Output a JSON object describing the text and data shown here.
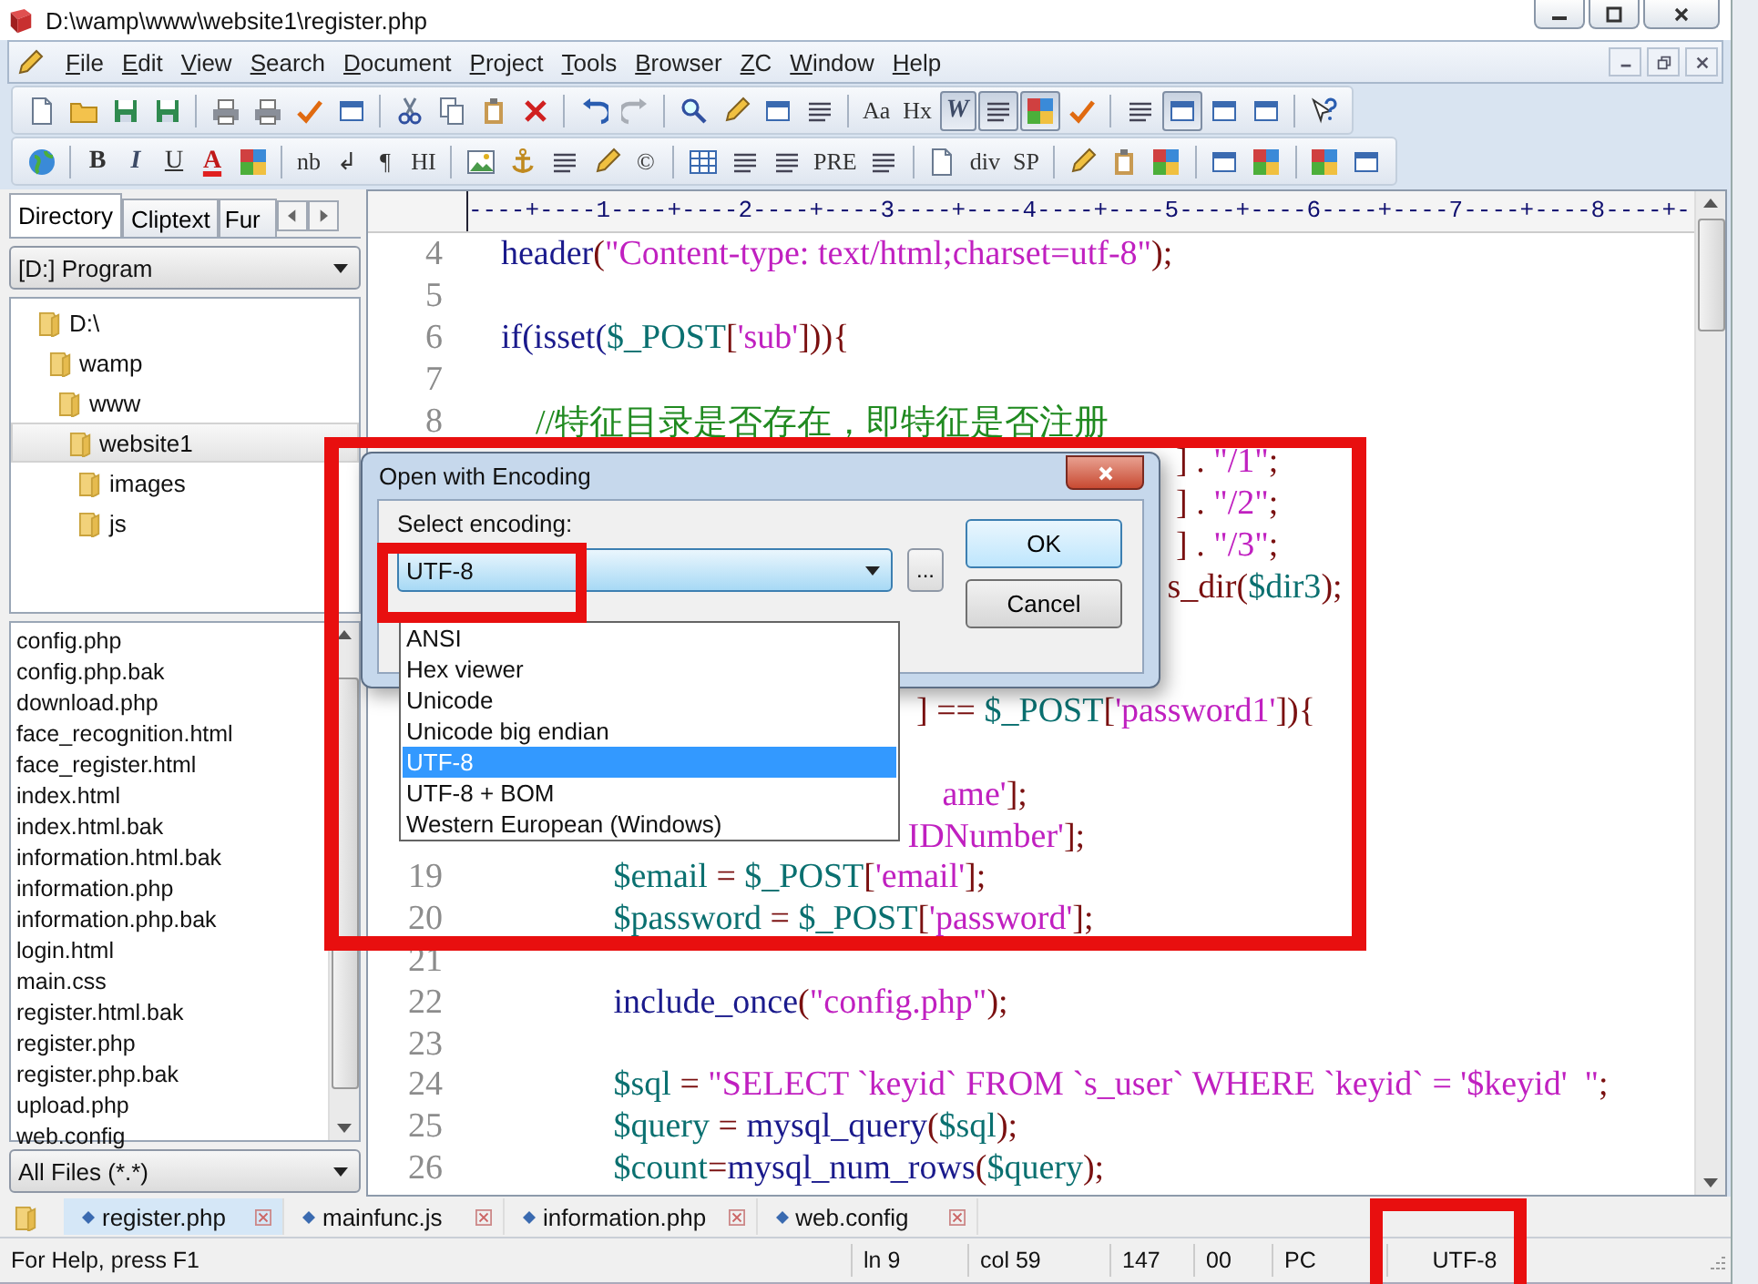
{
  "window": {
    "title": "D:\\wamp\\www\\website1\\register.php"
  },
  "menu": [
    "File",
    "Edit",
    "View",
    "Search",
    "Document",
    "Project",
    "Tools",
    "Browser",
    "ZC",
    "Window",
    "Help"
  ],
  "toolbars": [
    {
      "items": [
        {
          "kind": "icon",
          "pressed": false
        },
        {
          "kind": "icon",
          "pressed": false
        },
        {
          "kind": "icon",
          "pressed": false
        },
        {
          "kind": "icon",
          "pressed": false
        },
        {
          "kind": "sep"
        },
        {
          "kind": "icon",
          "pressed": false
        },
        {
          "kind": "icon",
          "pressed": false
        },
        {
          "kind": "icon",
          "pressed": false
        },
        {
          "kind": "icon",
          "pressed": false
        },
        {
          "kind": "sep"
        },
        {
          "kind": "icon",
          "pressed": false
        },
        {
          "kind": "icon",
          "pressed": false
        },
        {
          "kind": "icon",
          "pressed": false
        },
        {
          "kind": "icon",
          "pressed": false
        },
        {
          "kind": "sep"
        },
        {
          "kind": "icon",
          "pressed": false
        },
        {
          "kind": "icon",
          "pressed": false
        },
        {
          "kind": "sep"
        },
        {
          "kind": "icon",
          "pressed": false
        },
        {
          "kind": "icon",
          "pressed": false
        },
        {
          "kind": "icon",
          "pressed": false
        },
        {
          "kind": "icon",
          "pressed": false
        },
        {
          "kind": "sep"
        },
        {
          "kind": "text",
          "label": "Aa",
          "pressed": false
        },
        {
          "kind": "text",
          "label": "Hx",
          "pressed": false
        },
        {
          "kind": "italic",
          "label": "W",
          "pressed": true
        },
        {
          "kind": "icon",
          "pressed": true
        },
        {
          "kind": "icon",
          "pressed": true
        },
        {
          "kind": "icon",
          "pressed": false
        },
        {
          "kind": "sep"
        },
        {
          "kind": "icon",
          "pressed": false
        },
        {
          "kind": "icon",
          "pressed": true
        },
        {
          "kind": "icon",
          "pressed": false
        },
        {
          "kind": "icon",
          "pressed": false
        },
        {
          "kind": "sep"
        },
        {
          "kind": "icon",
          "pressed": false
        }
      ]
    },
    {
      "items": [
        {
          "kind": "icon",
          "pressed": false
        },
        {
          "kind": "sep"
        },
        {
          "kind": "bold",
          "label": "B",
          "pressed": false
        },
        {
          "kind": "italic",
          "label": "I",
          "pressed": false
        },
        {
          "kind": "underline",
          "label": "U",
          "pressed": false
        },
        {
          "kind": "color",
          "label": "A",
          "pressed": false
        },
        {
          "kind": "icon",
          "pressed": false
        },
        {
          "kind": "sep"
        },
        {
          "kind": "text",
          "label": "nb",
          "pressed": false
        },
        {
          "kind": "text",
          "label": "↲",
          "pressed": false
        },
        {
          "kind": "text",
          "label": "¶",
          "pressed": false
        },
        {
          "kind": "text",
          "label": "HI",
          "pressed": false
        },
        {
          "kind": "sep"
        },
        {
          "kind": "icon",
          "pressed": false
        },
        {
          "kind": "icon",
          "pressed": false
        },
        {
          "kind": "icon",
          "pressed": false
        },
        {
          "kind": "icon",
          "pressed": false
        },
        {
          "kind": "text",
          "label": "©",
          "pressed": false
        },
        {
          "kind": "sep"
        },
        {
          "kind": "icon",
          "pressed": false
        },
        {
          "kind": "icon",
          "pressed": false
        },
        {
          "kind": "icon",
          "pressed": false
        },
        {
          "kind": "text",
          "label": "PRE",
          "pressed": false
        },
        {
          "kind": "icon",
          "pressed": false
        },
        {
          "kind": "sep"
        },
        {
          "kind": "icon",
          "pressed": false
        },
        {
          "kind": "text",
          "label": "div",
          "pressed": false
        },
        {
          "kind": "text",
          "label": "SP",
          "pressed": false
        },
        {
          "kind": "sep"
        },
        {
          "kind": "icon",
          "pressed": false
        },
        {
          "kind": "icon",
          "pressed": false
        },
        {
          "kind": "icon",
          "pressed": false
        },
        {
          "kind": "sep"
        },
        {
          "kind": "icon",
          "pressed": false
        },
        {
          "kind": "icon",
          "pressed": false
        },
        {
          "kind": "sep"
        },
        {
          "kind": "icon",
          "pressed": false
        },
        {
          "kind": "icon",
          "pressed": false
        }
      ]
    }
  ],
  "sidebar": {
    "tabs": [
      {
        "label": "Directory",
        "selected": true
      },
      {
        "label": "Cliptext",
        "selected": false
      },
      {
        "label": "Fur",
        "selected": false
      }
    ],
    "drive": "[D:] Program",
    "tree": [
      {
        "label": "D:\\",
        "selected": false,
        "children": [
          {
            "label": "wamp",
            "selected": false,
            "children": [
              {
                "label": "www",
                "selected": false,
                "children": [
                  {
                    "label": "website1",
                    "selected": true,
                    "children": [
                      {
                        "label": "images",
                        "selected": false
                      },
                      {
                        "label": "js",
                        "selected": false
                      }
                    ]
                  }
                ]
              }
            ]
          }
        ]
      }
    ],
    "files": [
      {
        "label": "config.php",
        "selected": false
      },
      {
        "label": "config.php.bak",
        "selected": false
      },
      {
        "label": "download.php",
        "selected": false
      },
      {
        "label": "face_recognition.html",
        "selected": false
      },
      {
        "label": "face_register.html",
        "selected": false
      },
      {
        "label": "index.html",
        "selected": false
      },
      {
        "label": "index.html.bak",
        "selected": false
      },
      {
        "label": "information.html.bak",
        "selected": false
      },
      {
        "label": "information.php",
        "selected": false
      },
      {
        "label": "information.php.bak",
        "selected": false
      },
      {
        "label": "login.html",
        "selected": false
      },
      {
        "label": "main.css",
        "selected": false
      },
      {
        "label": "register.html.bak",
        "selected": false
      },
      {
        "label": "register.php",
        "selected": false
      },
      {
        "label": "register.php.bak",
        "selected": false
      },
      {
        "label": "upload.php",
        "selected": false
      },
      {
        "label": "web.config",
        "selected": false
      }
    ],
    "filter": "All Files (*.*)"
  },
  "editor": {
    "ruler": "----+----1----+----2----+----3----+----4----+----5----+----6----+----7----+----8----+-",
    "lines": [
      {
        "kind": "code",
        "number": "4",
        "tokens": [
          {
            "text": "    header",
            "kind": "fn"
          },
          {
            "text": "(",
            "kind": "op"
          },
          {
            "text": "\"Content-type: text/html;charset=utf-8\"",
            "kind": "str"
          },
          {
            "text": ");",
            "kind": "op"
          }
        ]
      },
      {
        "kind": "blank",
        "number": "5"
      },
      {
        "kind": "code",
        "number": "6",
        "tokens": [
          {
            "text": "    if(isset(",
            "kind": "fn"
          },
          {
            "text": "$_POST",
            "kind": "var"
          },
          {
            "text": "[",
            "kind": "op"
          },
          {
            "text": "'sub'",
            "kind": "str"
          },
          {
            "text": "])){",
            "kind": "op"
          }
        ]
      },
      {
        "kind": "blank",
        "number": "7"
      },
      {
        "kind": "code",
        "number": "8",
        "tokens": [
          {
            "text": "        //特征目录是否存在，即特征是否注册",
            "kind": "cmt"
          }
        ]
      },
      {
        "tokens": [
          {
            "text": "                                                                                  ] . ",
            "kind": "op"
          },
          {
            "text": "\"/1\"",
            "kind": "str"
          },
          {
            "text": ";",
            "kind": "op"
          }
        ],
        "kind": "code"
      },
      {
        "tokens": [
          {
            "text": "                                                                                  ] . ",
            "kind": "op"
          },
          {
            "text": "\"/2\"",
            "kind": "str"
          },
          {
            "text": ";",
            "kind": "op"
          }
        ],
        "kind": "code"
      },
      {
        "tokens": [
          {
            "text": "                                                                                  ] . ",
            "kind": "op"
          },
          {
            "text": "\"/3\"",
            "kind": "str"
          },
          {
            "text": ";",
            "kind": "op"
          }
        ],
        "kind": "code"
      },
      {
        "tokens": [
          {
            "text": "                                                                                 s_dir(",
            "kind": "op"
          },
          {
            "text": "$dir3",
            "kind": "var"
          },
          {
            "text": ");",
            "kind": "op"
          }
        ],
        "kind": "code"
      },
      {
        "kind": "blank"
      },
      {
        "kind": "blank"
      },
      {
        "tokens": [
          {
            "text": "                                                    ] == ",
            "kind": "op"
          },
          {
            "text": "$_POST",
            "kind": "var"
          },
          {
            "text": "[",
            "kind": "op"
          },
          {
            "text": "'password1'",
            "kind": "str"
          },
          {
            "text": "]){",
            "kind": "op"
          }
        ],
        "kind": "code"
      },
      {
        "kind": "blank"
      },
      {
        "tokens": [
          {
            "text": "                                                       ame'",
            "kind": "str"
          },
          {
            "text": "];",
            "kind": "op"
          }
        ],
        "kind": "code"
      },
      {
        "tokens": [
          {
            "text": "                                                   IDNumber'",
            "kind": "str"
          },
          {
            "text": "];",
            "kind": "op"
          }
        ],
        "kind": "code"
      },
      {
        "kind": "code",
        "number": "19",
        "tokens": [
          {
            "text": "                 $email",
            "kind": "var"
          },
          {
            "text": " = ",
            "kind": "op"
          },
          {
            "text": "$_POST",
            "kind": "var"
          },
          {
            "text": "[",
            "kind": "op"
          },
          {
            "text": "'email'",
            "kind": "str"
          },
          {
            "text": "];",
            "kind": "op"
          }
        ]
      },
      {
        "kind": "code",
        "number": "20",
        "tokens": [
          {
            "text": "                 $password",
            "kind": "var"
          },
          {
            "text": " = ",
            "kind": "op"
          },
          {
            "text": "$_POST",
            "kind": "var"
          },
          {
            "text": "[",
            "kind": "op"
          },
          {
            "text": "'password'",
            "kind": "str"
          },
          {
            "text": "];",
            "kind": "op"
          }
        ]
      },
      {
        "kind": "blank",
        "number": "21"
      },
      {
        "kind": "code",
        "number": "22",
        "tokens": [
          {
            "text": "                 include_once",
            "kind": "fn"
          },
          {
            "text": "(",
            "kind": "op"
          },
          {
            "text": "\"config.php\"",
            "kind": "str"
          },
          {
            "text": ");",
            "kind": "op"
          }
        ]
      },
      {
        "kind": "blank",
        "number": "23"
      },
      {
        "kind": "code",
        "number": "24",
        "tokens": [
          {
            "text": "                 $sql",
            "kind": "var"
          },
          {
            "text": " = ",
            "kind": "op"
          },
          {
            "text": "\"SELECT `keyid` FROM `s_user` WHERE `keyid` = '$keyid'  \"",
            "kind": "str"
          },
          {
            "text": ";",
            "kind": "op"
          }
        ]
      },
      {
        "kind": "code",
        "number": "25",
        "tokens": [
          {
            "text": "                 $query",
            "kind": "var"
          },
          {
            "text": " = ",
            "kind": "op"
          },
          {
            "text": "mysql_query",
            "kind": "fn"
          },
          {
            "text": "(",
            "kind": "op"
          },
          {
            "text": "$sql",
            "kind": "var"
          },
          {
            "text": ");",
            "kind": "op"
          }
        ]
      },
      {
        "kind": "code",
        "number": "26",
        "tokens": [
          {
            "text": "                 $count",
            "kind": "var"
          },
          {
            "text": "=",
            "kind": "op"
          },
          {
            "text": "mysql_num_rows",
            "kind": "fn"
          },
          {
            "text": "(",
            "kind": "op"
          },
          {
            "text": "$query",
            "kind": "var"
          },
          {
            "text": ");",
            "kind": "op"
          }
        ]
      }
    ]
  },
  "dialog": {
    "title": "Open with Encoding",
    "label": "Select encoding:",
    "value": "UTF-8",
    "browse": "...",
    "ok": "OK",
    "cancel": "Cancel",
    "options": [
      {
        "label": "ANSI",
        "selected": false
      },
      {
        "label": "Hex viewer",
        "selected": false
      },
      {
        "label": "Unicode",
        "selected": false
      },
      {
        "label": "Unicode big endian",
        "selected": false
      },
      {
        "label": "UTF-8",
        "selected": true
      },
      {
        "label": "UTF-8 + BOM",
        "selected": false
      },
      {
        "label": "Western European (Windows)",
        "selected": false
      }
    ]
  },
  "doc_tabs": [
    {
      "label": "register.php",
      "selected": true
    },
    {
      "label": "mainfunc.js",
      "selected": false
    },
    {
      "label": "information.php",
      "selected": false
    },
    {
      "label": "web.config",
      "selected": false
    }
  ],
  "status_bar": [
    "For Help, press F1",
    "ln 9",
    "col 59",
    "147",
    "00",
    "PC",
    "UTF-8"
  ]
}
